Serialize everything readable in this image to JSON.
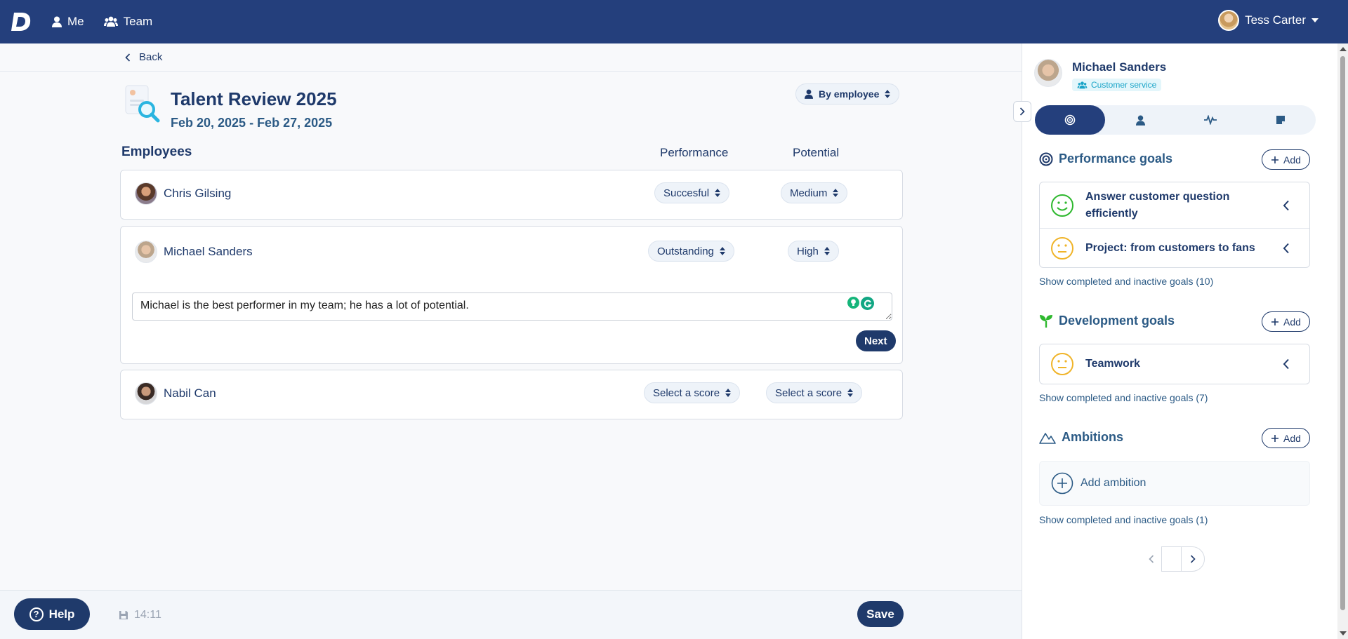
{
  "topbar": {
    "logo_letter": "D",
    "nav": [
      {
        "label": "Me"
      },
      {
        "label": "Team"
      }
    ],
    "user_name": "Tess Carter"
  },
  "main": {
    "back_label": "Back",
    "title": "Talent Review 2025",
    "dates": "Feb 20, 2025 - Feb 27, 2025",
    "view_select": "By employee",
    "columns": {
      "employees": "Employees",
      "performance": "Performance",
      "potential": "Potential"
    },
    "rows": [
      {
        "name": "Chris Gilsing",
        "performance": "Succesful",
        "potential": "Medium"
      },
      {
        "name": "Michael Sanders",
        "performance": "Outstanding",
        "potential": "High",
        "comment": "Michael is the best performer in my team; he has a lot of potential.",
        "next_label": "Next"
      },
      {
        "name": "Nabil Can",
        "performance": "Select a score",
        "potential": "Select a score"
      }
    ]
  },
  "footer": {
    "help_label": "Help",
    "help_glyph": "?",
    "saved_time": "14:11",
    "save_label": "Save"
  },
  "sidebar": {
    "name": "Michael Sanders",
    "department": "Customer service",
    "tabs": [
      "target-icon",
      "person-icon",
      "pulse-icon",
      "note-icon"
    ],
    "performance_goals": {
      "title": "Performance goals",
      "add_label": "Add",
      "items": [
        {
          "title": "Answer customer question efficiently",
          "mood": "happy"
        },
        {
          "title": "Project: from customers to fans",
          "mood": "neutral"
        }
      ],
      "show_more": "Show completed and inactive goals (10)"
    },
    "development_goals": {
      "title": "Development goals",
      "add_label": "Add",
      "items": [
        {
          "title": "Teamwork",
          "mood": "neutral"
        }
      ],
      "show_more": "Show completed and inactive goals (7)"
    },
    "ambitions": {
      "title": "Ambitions",
      "add_label": "Add",
      "add_ambition_label": "Add ambition",
      "show_more": "Show completed and inactive goals (1)"
    }
  },
  "colors": {
    "brand": "#243f7c",
    "accent": "#2b5a85",
    "happy": "#2eb82e",
    "neutral": "#f0b429",
    "badge": "#1aa4c8"
  }
}
